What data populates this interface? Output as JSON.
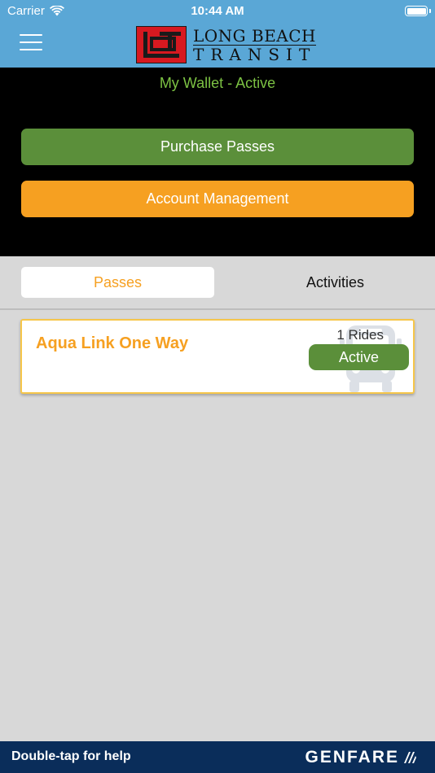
{
  "status_bar": {
    "carrier": "Carrier",
    "time": "10:44 AM",
    "wifi_icon": "wifi-icon",
    "battery_icon": "battery-icon"
  },
  "header": {
    "menu_icon": "hamburger-menu-icon",
    "logo_line1": "LONG BEACH",
    "logo_line2": "TRANSIT",
    "background_color": "#5aa7d6",
    "logo_color": "#d71920"
  },
  "wallet": {
    "title": "My Wallet - Active",
    "purchase_label": "Purchase Passes",
    "account_label": "Account Management",
    "title_color": "#7cc243",
    "purchase_color": "#5b8f3a",
    "account_color": "#f6a021"
  },
  "tabs": [
    {
      "label": "Passes",
      "selected": true
    },
    {
      "label": "Activities",
      "selected": false
    }
  ],
  "passes": [
    {
      "name": "Aqua Link One Way",
      "rides": "1 Rides",
      "status": "Active",
      "icon": "bus-icon"
    }
  ],
  "footer": {
    "help_text": "Double-tap for help",
    "brand": "GENFARE",
    "brand_icon": "genfare-logo-icon",
    "background_color": "#0a2d5a"
  }
}
